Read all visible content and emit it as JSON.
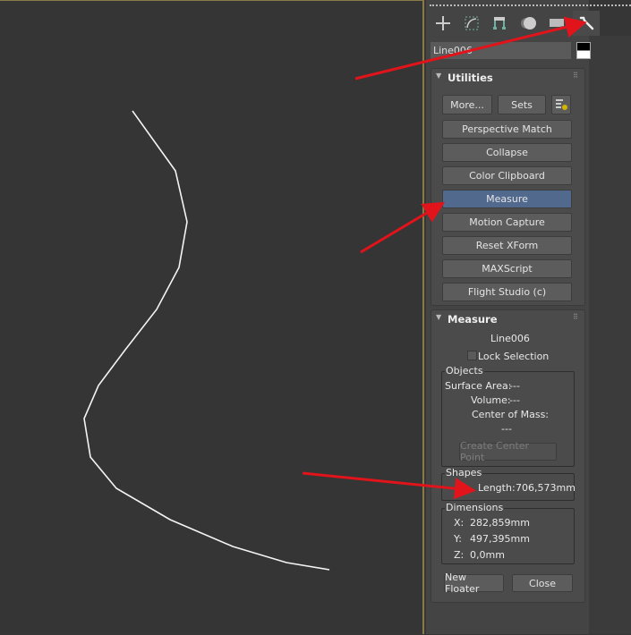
{
  "command_panel": {
    "tabs": [
      {
        "name": "create",
        "icon": "plus-icon"
      },
      {
        "name": "modify",
        "icon": "modify-icon"
      },
      {
        "name": "hierarchy",
        "icon": "hierarchy-icon"
      },
      {
        "name": "motion",
        "icon": "motion-icon"
      },
      {
        "name": "display",
        "icon": "display-icon"
      },
      {
        "name": "utilities",
        "icon": "wrench-icon",
        "active": true
      }
    ],
    "object_name": "Line006"
  },
  "utilities": {
    "title": "Utilities",
    "more_label": "More...",
    "sets_label": "Sets",
    "items": [
      "Perspective Match",
      "Collapse",
      "Color Clipboard",
      "Measure",
      "Motion Capture",
      "Reset XForm",
      "MAXScript",
      "Flight Studio (c)"
    ],
    "selected": "Measure"
  },
  "measure": {
    "title": "Measure",
    "object": "Line006",
    "lock_selection_label": "Lock Selection",
    "lock_selection_checked": false,
    "objects_group": "Objects",
    "surface_area_label": "Surface Area:",
    "surface_area": "---",
    "volume_label": "Volume:",
    "volume": "---",
    "center_of_mass_label": "Center of Mass:",
    "center_of_mass": "---",
    "create_center_point_label": "Create Center Point",
    "shapes_group": "Shapes",
    "length_label": "Length:",
    "length": "706,573mm",
    "dimensions_group": "Dimensions",
    "x_label": "X:",
    "x": "282,859mm",
    "y_label": "Y:",
    "y": "497,395mm",
    "z_label": "Z:",
    "z": "0,0mm",
    "new_floater_label": "New Floater",
    "close_label": "Close"
  },
  "colors": {
    "selected_button": "#52698e",
    "annotation_arrow": "#e0141a",
    "viewport_border": "#8a7a46"
  }
}
